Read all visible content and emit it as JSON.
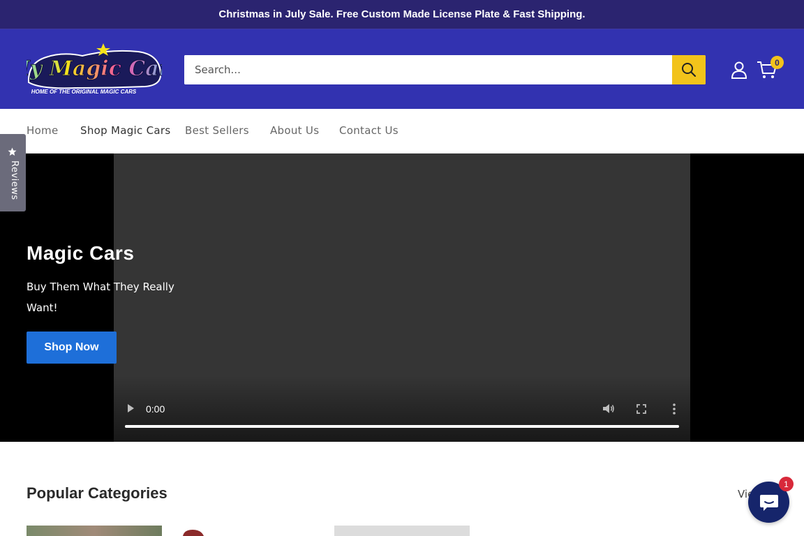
{
  "announcement": {
    "text": "Christmas in July Sale. Free Custom Made License Plate & Fast Shipping."
  },
  "header": {
    "logo": {
      "text": "My Magic Cars",
      "tagline": "HOME OF THE ORIGINAL MAGIC CARS"
    },
    "search": {
      "placeholder": "Search...",
      "button_icon": "search-icon"
    },
    "account_icon": "user-icon",
    "cart": {
      "icon": "cart-icon",
      "count": "0"
    },
    "colors": {
      "announcement_bg": "#2b2470",
      "header_bg": "#3232b0",
      "accent": "#f2c31b"
    }
  },
  "nav": {
    "items": [
      {
        "label": "Home"
      },
      {
        "label": "Shop Magic Cars"
      },
      {
        "label": "Best Sellers"
      },
      {
        "label": "About Us"
      },
      {
        "label": "Contact Us"
      }
    ]
  },
  "reviews_tab": {
    "label": "Reviews",
    "icon": "star-icon"
  },
  "hero": {
    "title": "Magic Cars",
    "subtitle": "Buy Them What They Really Want!",
    "button_label": "Shop Now",
    "button_color": "#1e6fd9",
    "video": {
      "time": "0:00",
      "progress": 1.0,
      "controls": [
        "play-icon",
        "volume-icon",
        "fullscreen-icon",
        "more-icon"
      ]
    }
  },
  "categories": {
    "title": "Popular Categories",
    "view_all_label": "View all"
  },
  "chat": {
    "icon": "chat-icon",
    "badge": "1"
  }
}
